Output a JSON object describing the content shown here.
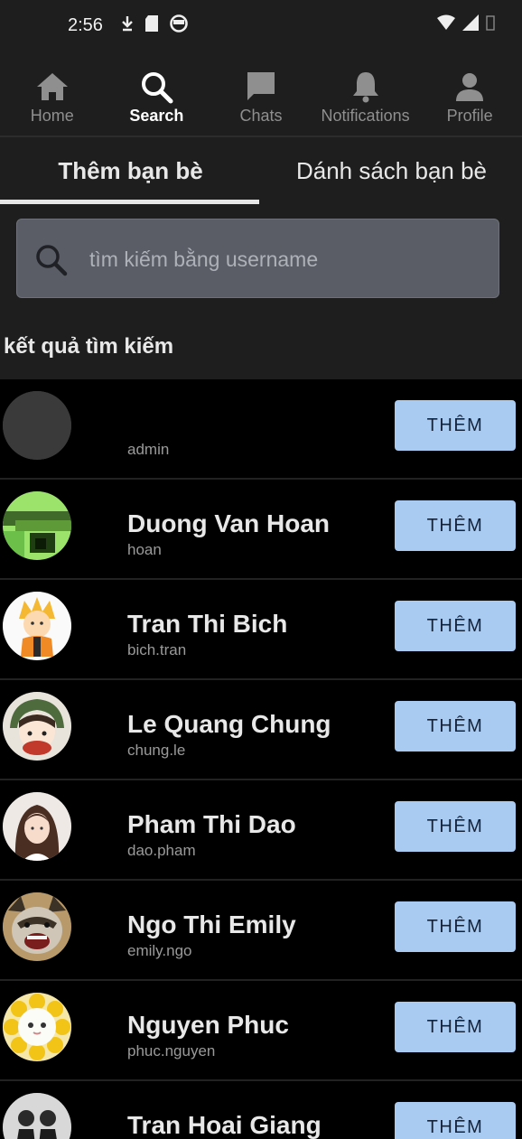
{
  "status_bar": {
    "time": "2:56"
  },
  "nav": {
    "items": [
      {
        "label": "Home",
        "icon": "home-icon"
      },
      {
        "label": "Search",
        "icon": "search-icon",
        "active": true
      },
      {
        "label": "Chats",
        "icon": "chat-icon"
      },
      {
        "label": "Notifications",
        "icon": "bell-icon"
      },
      {
        "label": "Profile",
        "icon": "person-icon"
      }
    ]
  },
  "tabs": [
    {
      "label": "Thêm bạn bè",
      "active": true
    },
    {
      "label": "Dánh sách bạn bè"
    }
  ],
  "search": {
    "placeholder": "tìm kiếm bằng username"
  },
  "results": {
    "title": "kết quả tìm kiếm",
    "add_label": "THÊM",
    "items": [
      {
        "name": "",
        "username": "admin"
      },
      {
        "name": "Duong Van Hoan",
        "username": "hoan"
      },
      {
        "name": "Tran Thi Bich",
        "username": "bich.tran"
      },
      {
        "name": "Le Quang Chung",
        "username": "chung.le"
      },
      {
        "name": "Pham Thi Dao",
        "username": "dao.pham"
      },
      {
        "name": "Ngo Thi Emily",
        "username": "emily.ngo"
      },
      {
        "name": "Nguyen Phuc",
        "username": "phuc.nguyen"
      },
      {
        "name": "Tran Hoai Giang",
        "username": ""
      }
    ]
  },
  "colors": {
    "background": "#000000",
    "panel": "#1e1e1e",
    "add_button": "#a9cbf2",
    "search_box": "#5a5d66"
  }
}
